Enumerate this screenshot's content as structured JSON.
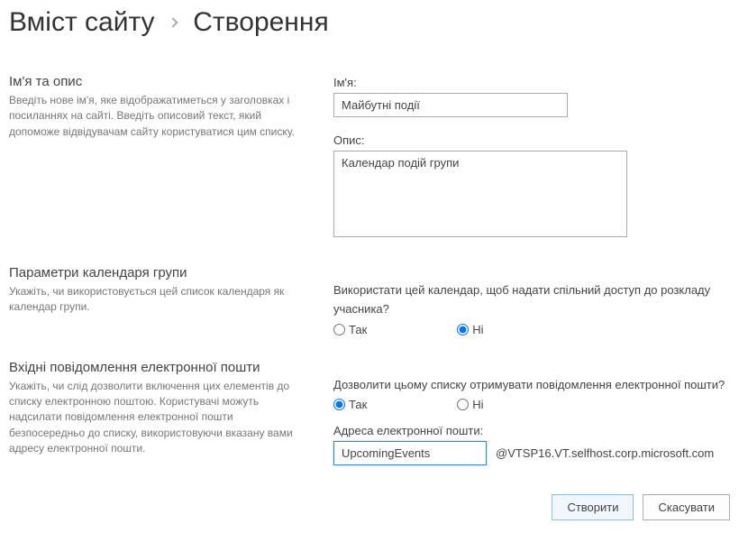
{
  "breadcrumb": {
    "parent": "Вміст сайту",
    "current": "Створення"
  },
  "nameSection": {
    "title": "Ім'я та опис",
    "desc": "Введіть нове ім'я, яке відображатиметься у заголовках і посиланнях на сайті. Введіть описовий текст, який допоможе відвідувачам сайту користуватися цим списку.",
    "nameLabel": "Ім'я:",
    "nameValue": "Майбутні події",
    "descLabel": "Опис:",
    "descValue": "Календар подій групи"
  },
  "groupCalendar": {
    "title": "Параметри календаря групи",
    "desc": "Укажіть, чи використовується цей список календаря як календар групи.",
    "question": "Використати цей календар, щоб надати спільний доступ до розкладу учасника?",
    "yes": "Так",
    "no": "Ні",
    "selected": "no"
  },
  "email": {
    "title": "Вхідні повідомлення електронної пошти",
    "desc": "Укажіть, чи слід дозволити включення цих елементів до списку електронною поштою. Користувачі можуть надсилати повідомлення електронної пошти безпосередньо до списку, використовуючи вказану вами адресу електронної пошти.",
    "question": "Дозволити цьому списку отримувати повідомлення електронної пошти?",
    "yes": "Так",
    "no": "Ні",
    "selected": "yes",
    "addressLabel": "Адреса електронної пошти:",
    "addressValue": "UpcomingEvents",
    "suffix": "@VTSP16.VT.selfhost.corp.microsoft.com"
  },
  "buttons": {
    "create": "Створити",
    "cancel": "Скасувати"
  }
}
